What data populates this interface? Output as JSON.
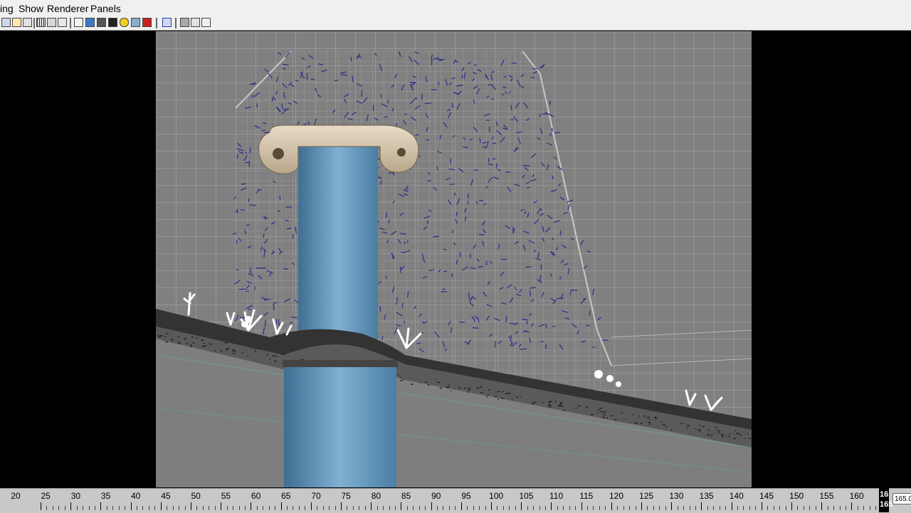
{
  "menu": {
    "items": [
      "ing",
      "Show",
      "Renderer",
      "Panels"
    ]
  },
  "toolbar": {
    "icons": [
      "camera-icon",
      "camera-attributes-icon",
      "bookmark-icon",
      "grid-icon",
      "film-gate-icon",
      "resolution-gate-icon",
      "wireframe-icon",
      "smooth-shade-icon",
      "flat-shade-icon",
      "shadow-icon",
      "light-icon",
      "texture-icon",
      "default-material-icon",
      "isolate-icon",
      "xray-icon",
      "wireframe-on-shaded-icon",
      "hud-icon"
    ]
  },
  "timeline": {
    "ticks": [
      "20",
      "25",
      "30",
      "35",
      "40",
      "45",
      "50",
      "55",
      "60",
      "65",
      "70",
      "75",
      "80",
      "85",
      "90",
      "95",
      "100",
      "105",
      "110",
      "115",
      "120",
      "125",
      "130",
      "135",
      "140",
      "145",
      "150",
      "155",
      "160"
    ],
    "current_frame": "165",
    "current_frame_top": "16",
    "end_frame": "165.0"
  },
  "colors": {
    "viewport_bg": "#808080",
    "waterfall": "#6a9cc0",
    "scroll": "#d8c8b0",
    "ground": "#3a3a3a",
    "particles": "#2a2a8a"
  }
}
